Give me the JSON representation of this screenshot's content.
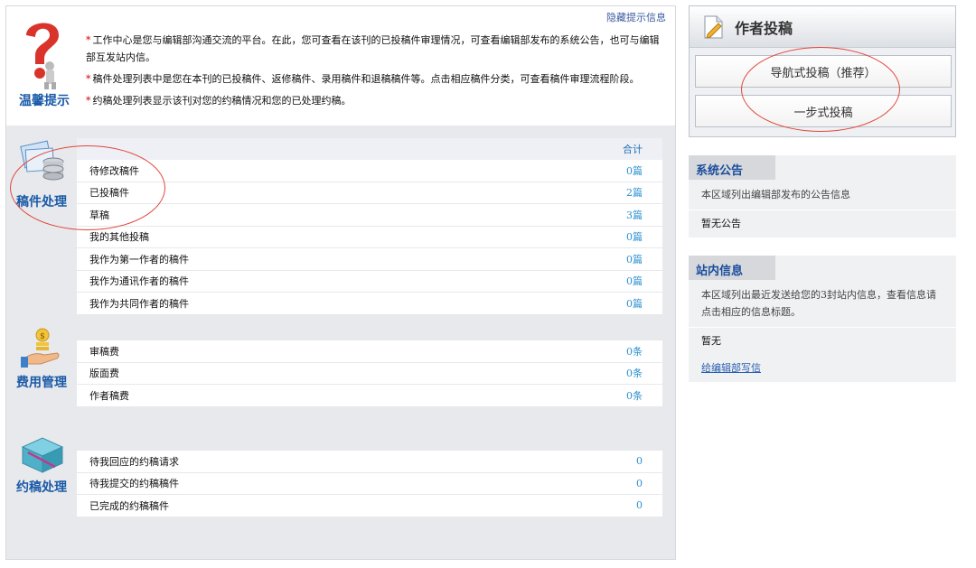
{
  "hint": {
    "hide_link": "隐藏提示信息",
    "label": "温馨提示",
    "lines": [
      "工作中心是您与编辑部沟通交流的平台。在此，您可查看在该刊的已投稿件审理情况，可查看编辑部发布的系统公告，也可与编辑部互发站内信。",
      "稿件处理列表中是您在本刊的已投稿件、返修稿件、录用稿件和退稿稿件等。点击相应稿件分类，可查看稿件审理流程阶段。",
      "约稿处理列表显示该刊对您的约稿情况和您的已处理约稿。"
    ]
  },
  "manuscripts": {
    "label": "稿件处理",
    "total_header": "合计",
    "rows": [
      {
        "name": "待修改稿件",
        "value": "0篇"
      },
      {
        "name": "已投稿件",
        "value": "2篇"
      },
      {
        "name": "草稿",
        "value": "3篇"
      },
      {
        "name": "我的其他投稿",
        "value": "0篇"
      },
      {
        "name": "我作为第一作者的稿件",
        "value": "0篇"
      },
      {
        "name": "我作为通讯作者的稿件",
        "value": "0篇"
      },
      {
        "name": "我作为共同作者的稿件",
        "value": "0篇"
      }
    ]
  },
  "fees": {
    "label": "费用管理",
    "rows": [
      {
        "name": "审稿费",
        "value": "0条"
      },
      {
        "name": "版面费",
        "value": "0条"
      },
      {
        "name": "作者稿费",
        "value": "0条"
      }
    ]
  },
  "invites": {
    "label": "约稿处理",
    "rows": [
      {
        "name": "待我回应的约稿请求",
        "value": "0"
      },
      {
        "name": "待我提交的约稿稿件",
        "value": "0"
      },
      {
        "name": "已完成的约稿稿件",
        "value": "0"
      }
    ]
  },
  "author": {
    "title": "作者投稿",
    "nav_button": "导航式投稿（推荐）",
    "step_button": "一步式投稿"
  },
  "notice": {
    "title": "系统公告",
    "desc": "本区域列出编辑部发布的公告信息",
    "item": "暂无公告"
  },
  "messages": {
    "title": "站内信息",
    "desc": "本区域列出最近发送给您的3封站内信息，查看信息请点击相应的信息标题。",
    "item": "暂无",
    "link": "给编辑部写信"
  },
  "colors": {
    "accent": "#1a5aa8",
    "annotation": "#e0463a",
    "star": "#d10000"
  }
}
